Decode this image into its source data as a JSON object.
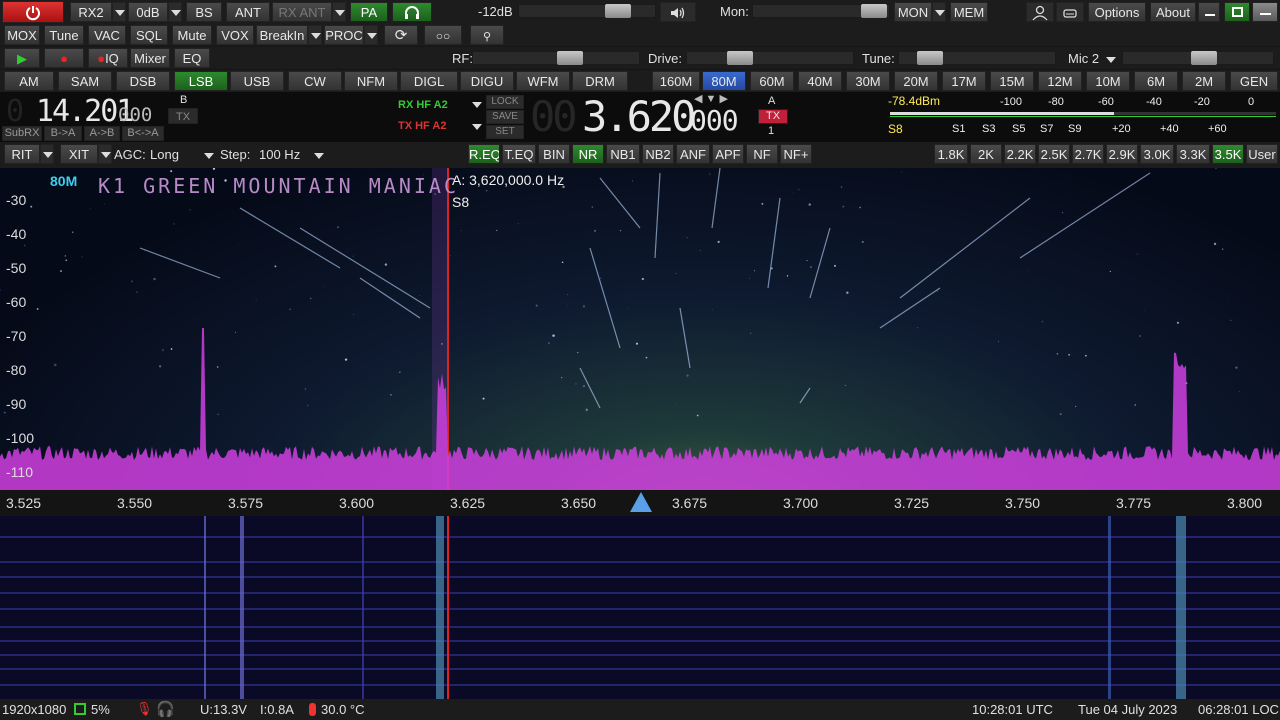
{
  "top": {
    "rx2": "RX2",
    "zero_db": "0dB",
    "bs": "BS",
    "ant": "ANT",
    "rx_ant": "RX ANT",
    "pa": "PA",
    "af_gain": "-12dB",
    "mon": "Mon:",
    "mon_btn": "MON",
    "mem": "MEM",
    "options": "Options",
    "about": "About"
  },
  "row2": {
    "items": [
      "MOX",
      "Tune",
      "VAC",
      "SQL",
      "Mute",
      "VOX",
      "BreakIn",
      "PROC"
    ]
  },
  "row3": {
    "iq": "IQ",
    "mixer": "Mixer",
    "eq": "EQ",
    "rf": "RF:",
    "drive": "Drive:",
    "tune": "Tune:",
    "mic": "Mic 2"
  },
  "modes": [
    "AM",
    "SAM",
    "DSB",
    "LSB",
    "USB",
    "CW",
    "NFM",
    "DIGL",
    "DIGU",
    "WFM",
    "DRM"
  ],
  "bands": [
    "160M",
    "80M",
    "60M",
    "40M",
    "30M",
    "20M",
    "17M",
    "15M",
    "12M",
    "10M",
    "6M",
    "2M",
    "GEN"
  ],
  "vfo_b": {
    "freq_main": "14.201",
    "freq_sub": "000",
    "b": "B",
    "tx": "TX",
    "subrx": "SubRX",
    "b_to_a": "B->A",
    "a_to_b": "A->B",
    "swap": "B<->A"
  },
  "ant_info": {
    "rx": "RX HF A2",
    "tx": "TX HF A2",
    "lock": "LOCK",
    "save": "SAVE",
    "set": "SET"
  },
  "vfo_a": {
    "freq_lead": "00",
    "freq_main": "3.620",
    "freq_sub": "000",
    "a": "A",
    "tx": "TX",
    "one": "1"
  },
  "smeter": {
    "dbm": "-78.4dBm",
    "scale_top": [
      "-100",
      "-80",
      "-60",
      "-40",
      "-20",
      "0"
    ],
    "scale_bottom": [
      "S1",
      "S3",
      "S5",
      "S7",
      "S9",
      "+20",
      "+40",
      "+60"
    ],
    "s_reading": "S8",
    "level": 0.58
  },
  "row6": {
    "rit": "RIT",
    "xit": "XIT",
    "agc_label": "AGC:",
    "agc": "Long",
    "step_label": "Step:",
    "step": "100 Hz",
    "dsp": [
      "R.EQ",
      "T.EQ",
      "BIN",
      "NR",
      "NB1",
      "NB2",
      "ANF",
      "APF",
      "NF",
      "NF+"
    ],
    "filters": [
      "1.8K",
      "2K",
      "2.2K",
      "2.5K",
      "2.7K",
      "2.9K",
      "3.0K",
      "3.3K",
      "3.5K",
      "User"
    ]
  },
  "spectrum": {
    "band": "80M",
    "title": "K1 GREEN MOUNTAIN MANIAC",
    "readout": "A: 3,620,000.0 Hz",
    "s_label": "S8",
    "db_ticks": [
      "-30",
      "-40",
      "-50",
      "-60",
      "-70",
      "-80",
      "-90",
      "-100",
      "-110"
    ]
  },
  "freq_axis": [
    "3.525",
    "3.550",
    "3.575",
    "3.600",
    "3.625",
    "3.650",
    "3.675",
    "3.700",
    "3.725",
    "3.750",
    "3.775",
    "3.800"
  ],
  "status": {
    "resolution": "1920x1080",
    "cpu": "5%",
    "voltage": "U:13.3V",
    "current": "I:0.8A",
    "temp": "30.0 °C",
    "utc": "10:28:01 UTC",
    "date": "Tue 04 July 2023",
    "local": "06:28:01 LOC"
  },
  "colors": {
    "accent_green": "#2f8a2f",
    "trace": "#d040e0",
    "band_label": "#3ad0f0",
    "tx_red": "#c0203a"
  }
}
